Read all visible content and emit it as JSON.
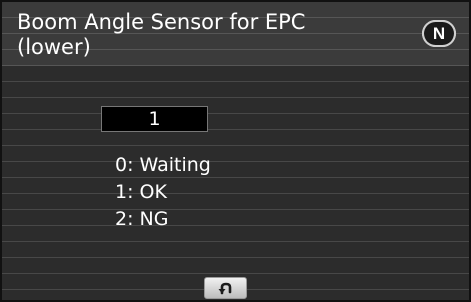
{
  "header": {
    "title": "Boom Angle Sensor for EPC (lower)",
    "mode_badge": "N"
  },
  "value_display": {
    "value": "1"
  },
  "legend": {
    "items": [
      {
        "label": "0: Waiting"
      },
      {
        "label": "1: OK"
      },
      {
        "label": "2: NG"
      }
    ]
  },
  "footer": {
    "back_icon": "return-arrow-icon"
  }
}
